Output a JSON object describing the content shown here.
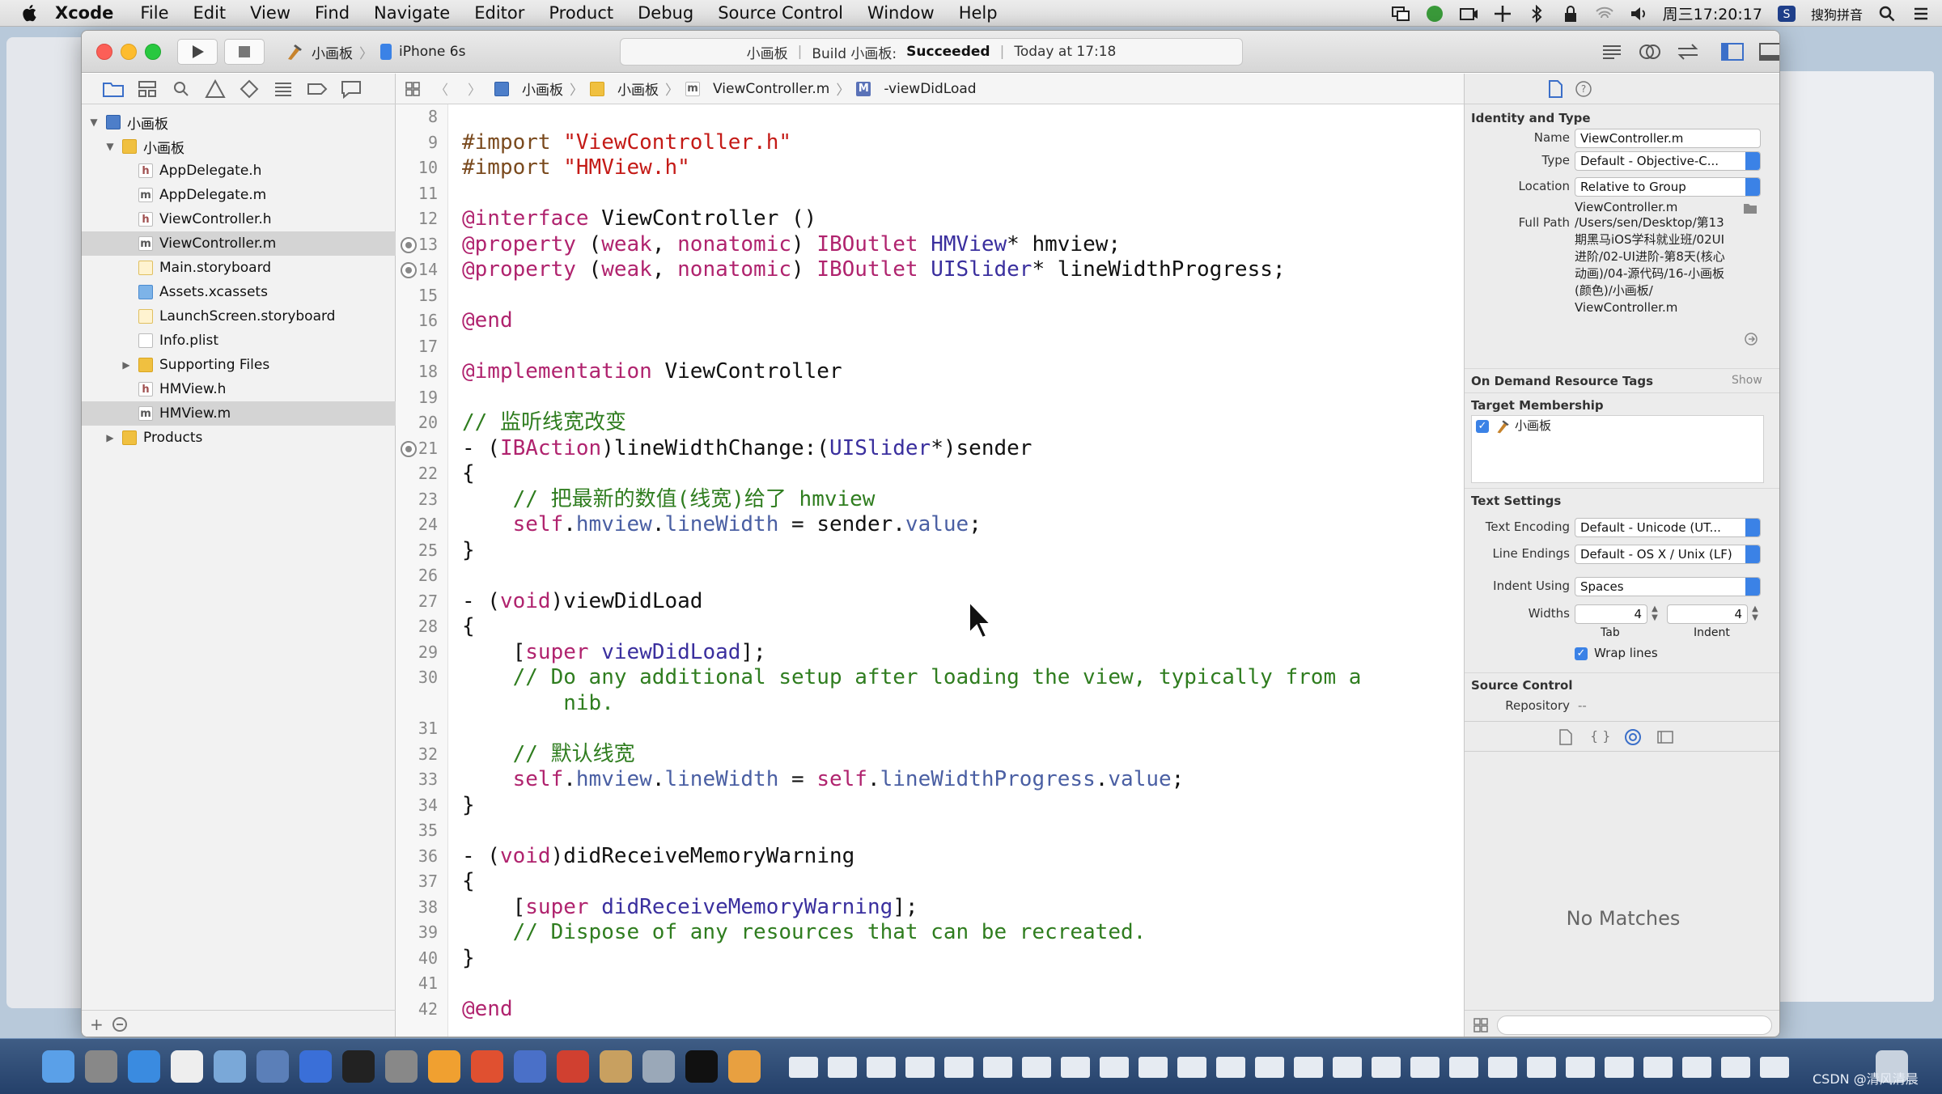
{
  "menubar": {
    "app": "Xcode",
    "items": [
      "File",
      "Edit",
      "View",
      "Find",
      "Navigate",
      "Editor",
      "Product",
      "Debug",
      "Source Control",
      "Window",
      "Help"
    ],
    "clock": "周三17:20:17",
    "input_method": "搜狗拼音"
  },
  "toolbar": {
    "scheme_target": "小画板",
    "device": "iPhone 6s",
    "activity_project": "小画板",
    "activity_build_label": "Build 小画板:",
    "activity_status": "Succeeded",
    "activity_time": "Today at 17:18"
  },
  "navigator": {
    "items": [
      {
        "name": "小画板",
        "type": "proj",
        "level": 0,
        "expanded": true
      },
      {
        "name": "小画板",
        "type": "folder",
        "level": 1,
        "expanded": true
      },
      {
        "name": "AppDelegate.h",
        "type": "h",
        "level": 2
      },
      {
        "name": "AppDelegate.m",
        "type": "m",
        "level": 2
      },
      {
        "name": "ViewController.h",
        "type": "h",
        "level": 2
      },
      {
        "name": "ViewController.m",
        "type": "m",
        "level": 2,
        "selected": true
      },
      {
        "name": "Main.storyboard",
        "type": "sb",
        "level": 2
      },
      {
        "name": "Assets.xcassets",
        "type": "asset",
        "level": 2
      },
      {
        "name": "LaunchScreen.storyboard",
        "type": "sb",
        "level": 2
      },
      {
        "name": "Info.plist",
        "type": "plist",
        "level": 2
      },
      {
        "name": "Supporting Files",
        "type": "folder",
        "level": 2,
        "collapsed": true
      },
      {
        "name": "HMView.h",
        "type": "h",
        "level": 2
      },
      {
        "name": "HMView.m",
        "type": "m",
        "level": 2,
        "selected": true
      },
      {
        "name": "Products",
        "type": "folder",
        "level": 1,
        "collapsed": true
      }
    ]
  },
  "jumpbar": {
    "crumbs": [
      "小画板",
      "小画板",
      "ViewController.m",
      "-viewDidLoad"
    ]
  },
  "editor": {
    "lines": [
      {
        "n": "8",
        "t": ""
      },
      {
        "n": "9",
        "t": "<span class='pp'>#import</span> <span class='str'>\"ViewController.h\"</span>"
      },
      {
        "n": "10",
        "t": "<span class='pp'>#import</span> <span class='str'>\"HMView.h\"</span>"
      },
      {
        "n": "11",
        "t": ""
      },
      {
        "n": "12",
        "t": "<span class='kw'>@interface</span> ViewController ()"
      },
      {
        "n": "13",
        "bp": true,
        "t": "<span class='kw'>@property</span> (<span class='kw'>weak</span>, <span class='kw'>nonatomic</span>) <span class='kw'>IBOutlet</span> <span class='cls'>HMView</span>* hmview;"
      },
      {
        "n": "14",
        "bp": true,
        "t": "<span class='kw'>@property</span> (<span class='kw'>weak</span>, <span class='kw'>nonatomic</span>) <span class='kw'>IBOutlet</span> <span class='cls'>UISlider</span>* lineWidthProgress;"
      },
      {
        "n": "15",
        "t": ""
      },
      {
        "n": "16",
        "t": "<span class='kw'>@end</span>"
      },
      {
        "n": "17",
        "t": ""
      },
      {
        "n": "18",
        "t": "<span class='kw'>@implementation</span> ViewController"
      },
      {
        "n": "19",
        "t": ""
      },
      {
        "n": "20",
        "t": "<span class='cm'>// 监听线宽改变</span>"
      },
      {
        "n": "21",
        "bp": true,
        "t": "- (<span class='kw'>IBAction</span>)lineWidthChange:(<span class='cls'>UISlider</span>*)sender"
      },
      {
        "n": "22",
        "t": "{"
      },
      {
        "n": "23",
        "t": "    <span class='cm'>// 把最新的数值(线宽)给了 hmview</span>"
      },
      {
        "n": "24",
        "t": "    <span class='kw'>self</span>.<span class='prop'>hmview</span>.<span class='prop'>lineWidth</span> = sender.<span class='prop'>value</span>;"
      },
      {
        "n": "25",
        "t": "}"
      },
      {
        "n": "26",
        "t": ""
      },
      {
        "n": "27",
        "t": "- (<span class='kw'>void</span>)viewDidLoad"
      },
      {
        "n": "28",
        "t": "{"
      },
      {
        "n": "29",
        "t": "    [<span class='kw'>super</span> <span class='cls'>viewDidLoad</span>];"
      },
      {
        "n": "30",
        "t": "    <span class='cm'>// Do any additional setup after loading the view, typically from a</span>"
      },
      {
        "n": "",
        "t": "        <span class='cm'>nib.</span>"
      },
      {
        "n": "31",
        "t": ""
      },
      {
        "n": "32",
        "t": "    <span class='cm'>// 默认线宽</span>"
      },
      {
        "n": "33",
        "t": "    <span class='kw'>self</span>.<span class='prop'>hmview</span>.<span class='prop'>lineWidth</span> = <span class='kw'>self</span>.<span class='prop'>lineWidthProgress</span>.<span class='prop'>value</span>;"
      },
      {
        "n": "34",
        "t": "}"
      },
      {
        "n": "35",
        "t": ""
      },
      {
        "n": "36",
        "t": "- (<span class='kw'>void</span>)didReceiveMemoryWarning"
      },
      {
        "n": "37",
        "t": "{"
      },
      {
        "n": "38",
        "t": "    [<span class='kw'>super</span> <span class='cls'>didReceiveMemoryWarning</span>];"
      },
      {
        "n": "39",
        "t": "    <span class='cm'>// Dispose of any resources that can be recreated.</span>"
      },
      {
        "n": "40",
        "t": "}"
      },
      {
        "n": "41",
        "t": ""
      },
      {
        "n": "42",
        "t": "<span class='kw'>@end</span>"
      }
    ]
  },
  "inspector": {
    "identity_title": "Identity and Type",
    "name_label": "Name",
    "name_value": "ViewController.m",
    "type_label": "Type",
    "type_value": "Default - Objective-C...",
    "location_label": "Location",
    "location_value": "Relative to Group",
    "location_file": "ViewController.m",
    "fullpath_label": "Full Path",
    "fullpath_lines": [
      "/Users/sen/Desktop/第13",
      "期黑马iOS学科就业班/02UI",
      "进阶/02-UI进阶-第8天(核心",
      "动画)/04-源代码/16-小画板",
      "(颜色)/小画板/",
      "ViewController.m"
    ],
    "ondemand_title": "On Demand Resource Tags",
    "ondemand_show": "Show",
    "target_title": "Target Membership",
    "target_name": "小画板",
    "text_title": "Text Settings",
    "encoding_label": "Text Encoding",
    "encoding_value": "Default - Unicode (UT...",
    "endings_label": "Line Endings",
    "endings_value": "Default - OS X / Unix (LF)",
    "indent_label": "Indent Using",
    "indent_value": "Spaces",
    "widths_label": "Widths",
    "tab_value": "4",
    "indent_width_value": "4",
    "tab_caption": "Tab",
    "indent_caption": "Indent",
    "wrap_label": "Wrap lines",
    "source_title": "Source Control",
    "repo_label": "Repository",
    "repo_value": "--",
    "no_matches": "No Matches"
  },
  "watermark": "CSDN @清风清晨",
  "colors": {
    "accent": "#3b82e6",
    "keyword": "#b0236e",
    "comment": "#2f7d1f",
    "string": "#c41a16"
  }
}
